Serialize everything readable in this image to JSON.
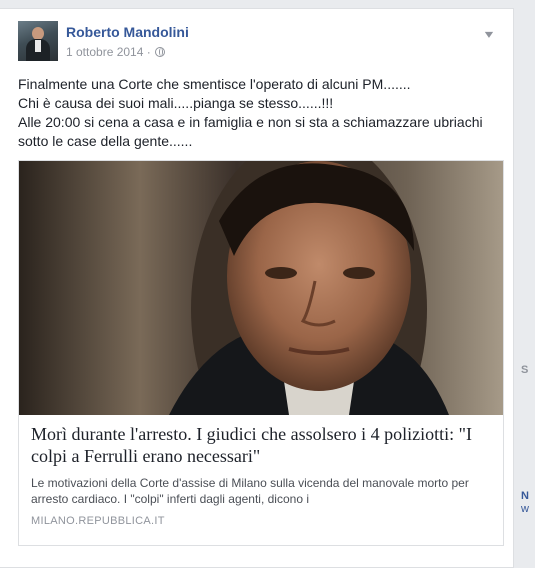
{
  "post": {
    "author": "Roberto Mandolini",
    "date": "1 ottobre 2014 ·",
    "chevron_icon": "chevron-down-icon",
    "text_lines": [
      "Finalmente una Corte che smentisce l'operato di alcuni PM.......",
      "Chi è causa dei suoi mali.....pianga se stesso......!!!",
      "Alle 20:00 si cena a casa e in famiglia e non si sta a schiamazzare ubriachi sotto le case della gente......"
    ]
  },
  "link_card": {
    "title": "Morì durante l'arresto. I giudici che assolsero i 4 poliziotti: \"I colpi a Ferrulli erano necessari\"",
    "description": "Le motivazioni della Corte d'assise di Milano sulla vicenda del manovale morto per arresto cardiaco. I \"colpi\" inferti dagli agenti, dicono i",
    "source": "MILANO.REPUBBLICA.IT"
  },
  "sidebar_fragments": {
    "s": "S",
    "n": "N",
    "w": "w"
  },
  "colors": {
    "link": "#365899",
    "meta": "#90949c",
    "background": "#e9ebee"
  }
}
